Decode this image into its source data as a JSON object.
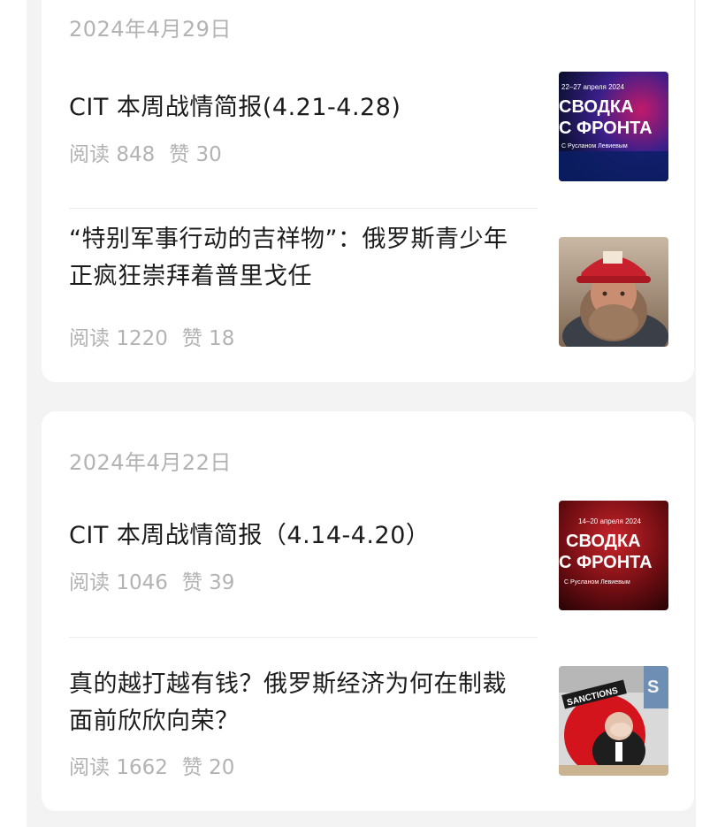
{
  "groups": [
    {
      "date": "2024年4月29日",
      "articles": [
        {
          "title": "CIT 本周战情简报(4.21-4.28)",
          "read_label": "阅读",
          "reads": "848",
          "like_label": "赞",
          "likes": "30",
          "thumb": {
            "icon": "svodka-s-fronta-cover-icon",
            "line1": "22–27 апреля 2024",
            "line2": "СВОДКА",
            "line3": "С ФРОНТА",
            "line4": "С Русланом Левиевым",
            "accent": "#1b3f9a"
          }
        },
        {
          "title": "“特别军事行动的吉祥物”：俄罗斯青少年正疯狂崇拜着普里戈任",
          "read_label": "阅读",
          "reads": "1220",
          "like_label": "赞",
          "likes": "18",
          "thumb": {
            "icon": "bearded-man-red-cap-photo-icon"
          }
        }
      ]
    },
    {
      "date": "2024年4月22日",
      "articles": [
        {
          "title": "CIT 本周战情简报（4.14-4.20）",
          "read_label": "阅读",
          "reads": "1046",
          "like_label": "赞",
          "likes": "39",
          "thumb": {
            "icon": "svodka-s-fronta-cover-icon",
            "line1": "14–20 апреля 2024",
            "line2": "СВОДКА",
            "line3": "С ФРОНТА",
            "line4": "С Русланом Левиевым",
            "accent": "#8a0f14"
          }
        },
        {
          "title": "真的越打越有钱？俄罗斯经济为何在制裁面前欣欣向荣？",
          "read_label": "阅读",
          "reads": "1662",
          "like_label": "赞",
          "likes": "20",
          "thumb": {
            "icon": "sanctions-collage-icon",
            "stamp": "SANCTIONS"
          }
        }
      ]
    }
  ]
}
